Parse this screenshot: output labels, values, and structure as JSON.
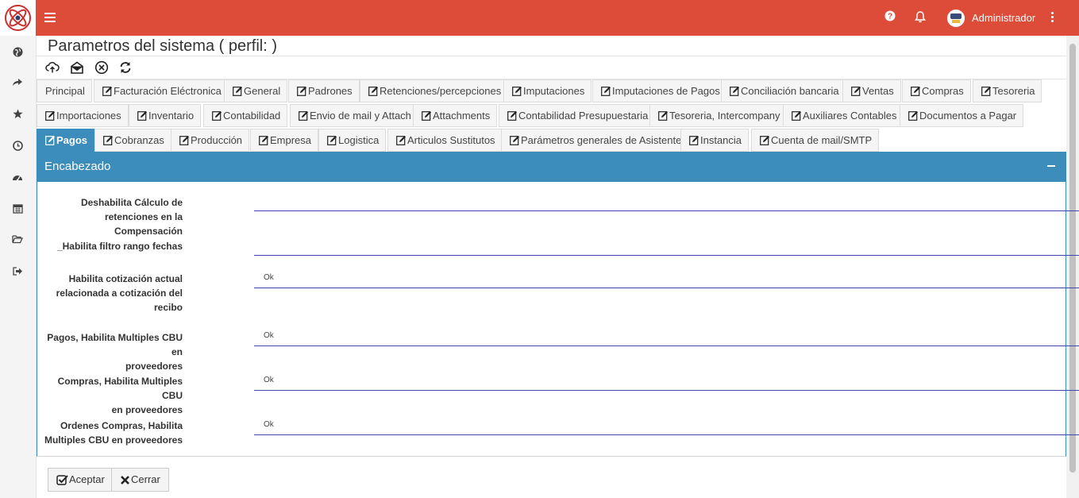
{
  "header": {
    "user_name": "Administrador",
    "colors": {
      "topbar": "#dd4b39",
      "accent": "#3c8dbc"
    },
    "icons": [
      "logo-icon",
      "hamburger-icon",
      "help-icon",
      "bell-icon",
      "avatar",
      "vertical-dots-icon"
    ]
  },
  "sidebar": {
    "icons": [
      "globe-icon",
      "share-icon",
      "star-icon",
      "clock-icon",
      "dashboard-icon",
      "calendar-icon",
      "folder-open-icon",
      "sign-out-icon"
    ]
  },
  "page": {
    "title": "Parametros del sistema ( perfil: )"
  },
  "toolbar": {
    "icons": [
      "cloud-upload-icon",
      "envelope-open-icon",
      "close-circle-icon",
      "refresh-icon"
    ]
  },
  "tabs": {
    "row1": [
      "Principal",
      "Facturación Eléctronica",
      "General",
      "Padrones",
      "Retenciones/percepciones",
      "Imputaciones",
      "Imputaciones de Pagos",
      "Conciliación bancaria",
      "Ventas",
      "Compras",
      "Tesoreria"
    ],
    "row2": [
      "Importaciones",
      "Inventario",
      "Contabilidad",
      "Envio de mail y Attach",
      "Attachments",
      "Contabilidad Presupuestaria",
      "Tesoreria, Intercompany",
      "Auxiliares Contables",
      "Documentos a Pagar"
    ],
    "row3": [
      "Pagos",
      "Cobranzas",
      "Producción",
      "Empresa",
      "Logistica",
      "Articulos Sustitutos",
      "Parámetros generales de Asistentes",
      "Instancia",
      "Cuenta de mail/SMTP"
    ],
    "active": "Pagos"
  },
  "panel": {
    "title": "Encabezado",
    "fields": [
      {
        "label_lines": [
          "Deshabilita Cálculo de",
          "retenciones en la Compensación"
        ],
        "value": ""
      },
      {
        "label_lines": [
          "_Habilita filtro rango fechas"
        ],
        "value": ""
      },
      {
        "label_lines": [
          "Habilita cotización actual",
          "relacionada a cotización del",
          "recibo"
        ],
        "value": "Ok"
      },
      {
        "label_lines": [
          "Pagos, Habilita Multiples CBU en",
          "proveedores"
        ],
        "value": "Ok"
      },
      {
        "label_lines": [
          "Compras, Habilita Multiples CBU",
          "en proveedores"
        ],
        "value": "Ok"
      },
      {
        "label_lines": [
          "Ordenes Compras, Habilita",
          "Multiples CBU en proveedores"
        ],
        "value": "Ok"
      }
    ]
  },
  "footer": {
    "accept_label": "Aceptar",
    "close_label": "Cerrar"
  }
}
